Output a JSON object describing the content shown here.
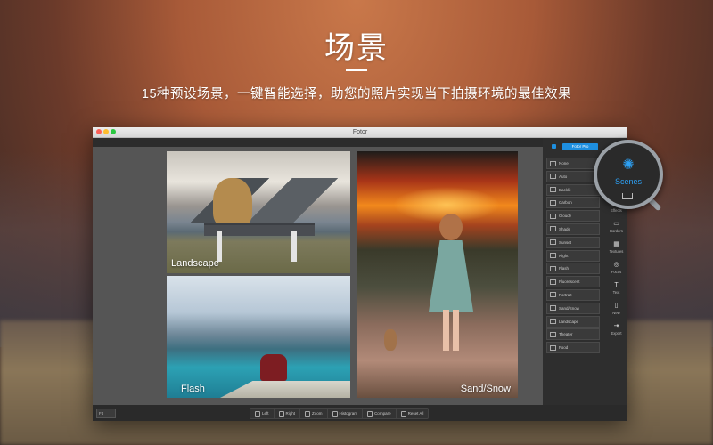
{
  "hero": {
    "title": "场景",
    "subtitle": "15种预设场景，一键智能选择，助您的照片实现当下拍摄环境的最佳效果"
  },
  "window": {
    "title": "Fotor"
  },
  "photos": [
    {
      "label": "Landscape"
    },
    {
      "label": "Flash"
    },
    {
      "label": "Sand/Snow"
    }
  ],
  "panel": {
    "pro_label": "Fotor Pro",
    "scenes": [
      "None",
      "Auto",
      "Backlit",
      "Carbon",
      "Cloudy",
      "Shade",
      "Sunset",
      "Night",
      "Flash",
      "Fluorescent",
      "Portrait",
      "Sand/Snow",
      "Landscape",
      "Theater",
      "Food"
    ]
  },
  "tools": [
    {
      "label": "Effects",
      "icon": "effects-icon"
    },
    {
      "label": "Borders",
      "icon": "borders-icon"
    },
    {
      "label": "Textures",
      "icon": "textures-icon"
    },
    {
      "label": "Focus",
      "icon": "focus-icon"
    },
    {
      "label": "Text",
      "icon": "text-icon"
    },
    {
      "label": "New",
      "icon": "new-file-icon"
    },
    {
      "label": "Export",
      "icon": "export-icon"
    }
  ],
  "magnifier": {
    "label": "Scenes",
    "icon": "sun-icon"
  },
  "bottombar": {
    "zoom": "Fit",
    "buttons": [
      "Left",
      "Right",
      "Zoom",
      "Histogram",
      "Compare",
      "Reset All"
    ]
  },
  "colors": {
    "accent": "#1e8fe0",
    "scenes_highlight": "#2da1f5"
  }
}
